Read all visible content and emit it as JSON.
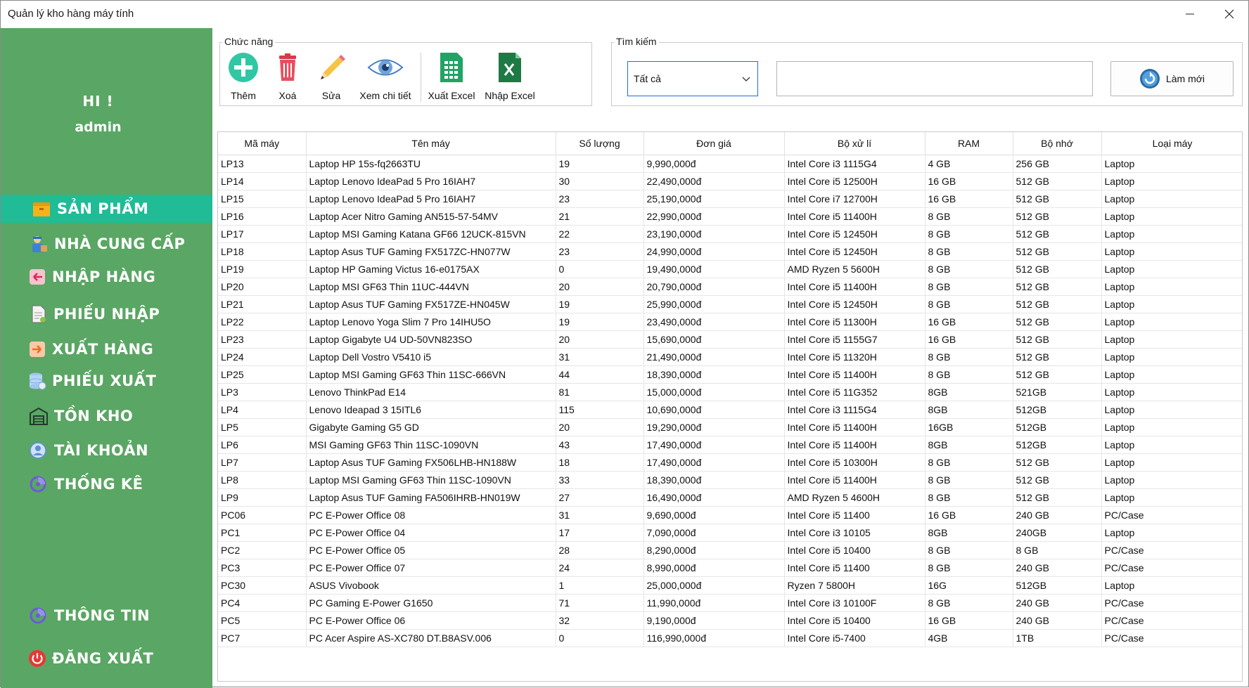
{
  "window": {
    "title": "Quản lý kho hàng máy tính"
  },
  "sidebar": {
    "greeting": "HI !",
    "username": "admin",
    "items": [
      {
        "label": "SẢN PHẨM",
        "icon": "box-icon",
        "active": true
      },
      {
        "label": "NHÀ CUNG CẤP",
        "icon": "supplier-icon",
        "active": false
      },
      {
        "label": "NHẬP HÀNG",
        "icon": "import-arrow-icon",
        "active": false
      },
      {
        "label": "PHIẾU NHẬP",
        "icon": "document-icon",
        "active": false
      },
      {
        "label": "XUẤT HÀNG",
        "icon": "export-arrow-icon",
        "active": false
      },
      {
        "label": "PHIẾU XUẤT",
        "icon": "database-icon",
        "active": false
      },
      {
        "label": "TỒN KHO",
        "icon": "warehouse-icon",
        "active": false
      },
      {
        "label": "TÀI KHOẢN",
        "icon": "account-icon",
        "active": false
      },
      {
        "label": "THỐNG KÊ",
        "icon": "chart-icon",
        "active": false
      },
      {
        "label": "THÔNG TIN",
        "icon": "info-icon",
        "active": false
      },
      {
        "label": "ĐĂNG XUẤT",
        "icon": "power-icon",
        "active": false
      }
    ]
  },
  "toolbar": {
    "group_title": "Chức năng",
    "add_label": "Thêm",
    "delete_label": "Xoá",
    "edit_label": "Sửa",
    "view_label": "Xem chi tiết",
    "export_label": "Xuất Excel",
    "import_label": "Nhập Excel"
  },
  "search": {
    "group_title": "Tìm kiếm",
    "filter_value": "Tất cả",
    "query": "",
    "refresh_label": "Làm mới"
  },
  "colors": {
    "sidebar": "#5aa664",
    "active": "#1fbc96"
  },
  "table": {
    "headers": [
      "Mã máy",
      "Tên máy",
      "Số lượng",
      "Đơn giá",
      "Bộ xử lí",
      "RAM",
      "Bộ nhớ",
      "Loại máy"
    ],
    "rows": [
      [
        "LP13",
        "Laptop HP 15s-fq2663TU",
        "19",
        "9,990,000đ",
        "Intel Core i3 1115G4",
        "4 GB",
        "256 GB",
        "Laptop"
      ],
      [
        "LP14",
        "Laptop Lenovo IdeaPad 5 Pro 16IAH7",
        "30",
        "22,490,000đ",
        "Intel Core i5 12500H",
        "16 GB",
        "512 GB",
        "Laptop"
      ],
      [
        "LP15",
        "Laptop Lenovo IdeaPad 5 Pro 16IAH7",
        "23",
        "25,190,000đ",
        "Intel Core i7 12700H",
        "16 GB",
        "512 GB",
        "Laptop"
      ],
      [
        "LP16",
        "Laptop Acer Nitro Gaming AN515-57-54MV",
        "21",
        "22,990,000đ",
        "Intel Core i5 11400H",
        "8 GB",
        "512 GB",
        "Laptop"
      ],
      [
        "LP17",
        "Laptop MSI Gaming Katana GF66 12UCK-815VN",
        "22",
        "23,190,000đ",
        "Intel Core i5 12450H",
        "8 GB",
        "512 GB",
        "Laptop"
      ],
      [
        "LP18",
        "Laptop Asus TUF Gaming FX517ZC-HN077W",
        "23",
        "24,990,000đ",
        "Intel Core i5 12450H",
        "8 GB",
        "512 GB",
        "Laptop"
      ],
      [
        "LP19",
        "Laptop HP Gaming Victus 16-e0175AX",
        "0",
        "19,490,000đ",
        "AMD Ryzen 5 5600H",
        "8 GB",
        "512 GB",
        "Laptop"
      ],
      [
        "LP20",
        "Laptop MSI GF63 Thin 11UC-444VN",
        "20",
        "20,790,000đ",
        "Intel Core i5 11400H",
        "8 GB",
        "512 GB",
        "Laptop"
      ],
      [
        "LP21",
        "Laptop Asus TUF Gaming FX517ZE-HN045W",
        "19",
        "25,990,000đ",
        "Intel Core i5 12450H",
        "8 GB",
        "512 GB",
        "Laptop"
      ],
      [
        "LP22",
        "Laptop Lenovo Yoga Slim 7 Pro 14IHU5O",
        "19",
        "23,490,000đ",
        "Intel Core i5 11300H",
        "16 GB",
        "512 GB",
        "Laptop"
      ],
      [
        "LP23",
        "Laptop Gigabyte U4 UD-50VN823SO",
        "20",
        "15,690,000đ",
        "Intel Core i5 1155G7",
        "16 GB",
        "512 GB",
        "Laptop"
      ],
      [
        "LP24",
        "Laptop Dell Vostro V5410 i5",
        "31",
        "21,490,000đ",
        "Intel Core i5 11320H",
        "8 GB",
        "512 GB",
        "Laptop"
      ],
      [
        "LP25",
        "Laptop MSI Gaming GF63 Thin 11SC-666VN",
        "44",
        "18,390,000đ",
        "Intel Core i5 11400H",
        "8 GB",
        "512 GB",
        "Laptop"
      ],
      [
        "LP3",
        "Lenovo ThinkPad E14",
        "81",
        "15,000,000đ",
        "Intel Core i5 11G352",
        "8GB",
        "521GB",
        "Laptop"
      ],
      [
        "LP4",
        "Lenovo Ideapad 3 15ITL6",
        "115",
        "10,690,000đ",
        "Intel Core i3 1115G4",
        "8GB",
        "512GB",
        "Laptop"
      ],
      [
        "LP5",
        "Gigabyte Gaming G5 GD",
        "20",
        "19,290,000đ",
        "Intel Core i5 11400H",
        "16GB",
        "512GB",
        "Laptop"
      ],
      [
        "LP6",
        "MSI Gaming GF63 Thin 11SC-1090VN",
        "43",
        "17,490,000đ",
        "Intel Core i5 11400H",
        "8GB",
        "512GB",
        "Laptop"
      ],
      [
        "LP7",
        "Laptop Asus TUF Gaming FX506LHB-HN188W",
        "18",
        "17,490,000đ",
        "Intel Core i5 10300H",
        "8 GB",
        "512 GB",
        "Laptop"
      ],
      [
        "LP8",
        "Laptop MSI Gaming GF63 Thin 11SC-1090VN",
        "33",
        "18,390,000đ",
        "Intel Core i5 11400H",
        "8 GB",
        "512 GB",
        "Laptop"
      ],
      [
        "LP9",
        "Laptop Asus TUF Gaming FA506IHRB-HN019W",
        "27",
        "16,490,000đ",
        "AMD Ryzen 5 4600H",
        "8 GB",
        "512 GB",
        "Laptop"
      ],
      [
        "PC06",
        "PC E-Power Office 08",
        "31",
        "9,690,000đ",
        "Intel Core i5 11400",
        "16 GB",
        "240 GB",
        "PC/Case"
      ],
      [
        "PC1",
        "PC E-Power Office 04",
        "17",
        "7,090,000đ",
        "Intel Core i3 10105",
        "8GB",
        "240GB",
        "Laptop"
      ],
      [
        "PC2",
        "PC E-Power Office 05",
        "28",
        "8,290,000đ",
        "Intel Core i5 10400",
        "8 GB",
        "8 GB",
        "PC/Case"
      ],
      [
        "PC3",
        "PC E-Power Office 07",
        "24",
        "8,990,000đ",
        "Intel Core i5 11400",
        "8 GB",
        "240 GB",
        "PC/Case"
      ],
      [
        "PC30",
        "ASUS Vivobook",
        "1",
        "25,000,000đ",
        " Ryzen 7 5800H",
        "16G",
        "512GB",
        "Laptop"
      ],
      [
        "PC4",
        "PC Gaming E-Power G1650",
        "71",
        "11,990,000đ",
        "Intel Core i3 10100F",
        "8 GB",
        "240 GB",
        "PC/Case"
      ],
      [
        "PC5",
        "PC E-Power Office 06",
        "32",
        "9,190,000đ",
        "Intel Core i5 10400",
        "16 GB",
        "240 GB",
        "PC/Case"
      ],
      [
        "PC7",
        "PC Acer Aspire AS-XC780 DT.B8ASV.006",
        "0",
        "116,990,000đ",
        " Intel Core i5-7400",
        "4GB",
        "1TB",
        "PC/Case"
      ]
    ]
  }
}
